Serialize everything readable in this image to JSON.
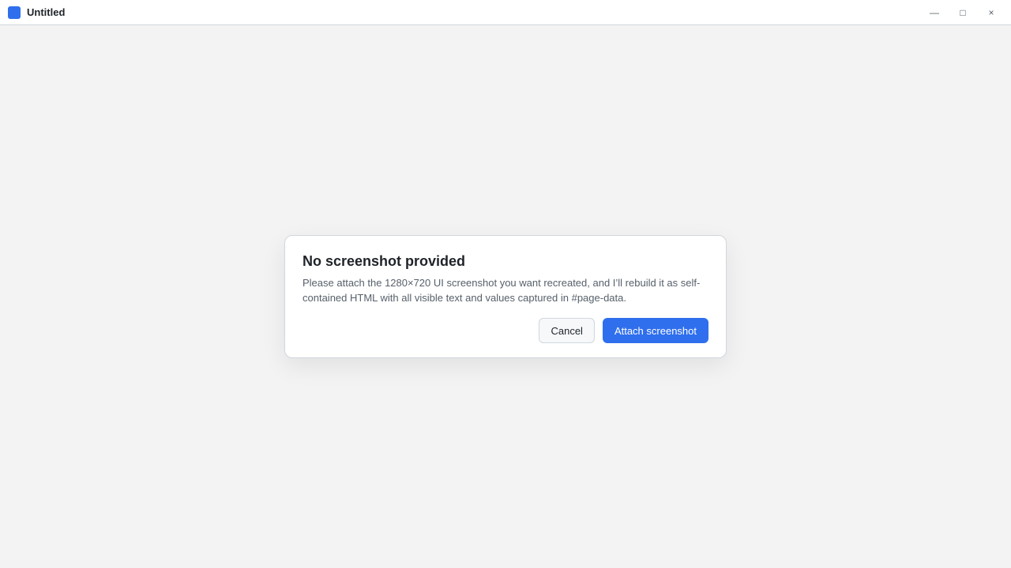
{
  "window": {
    "title": "Untitled"
  },
  "controls": {
    "minimize_glyph": "—",
    "maximize_glyph": "□",
    "close_glyph": "×"
  },
  "notice": {
    "heading": "No screenshot provided",
    "message": "Please attach the 1280×720 UI screenshot you want recreated, and I’ll rebuild it as self-contained HTML with all visible text and values captured in #page-data."
  },
  "buttons": {
    "secondary_label": "Cancel",
    "primary_label": "Attach screenshot"
  },
  "theme": {
    "accent": "#2f6fed"
  }
}
